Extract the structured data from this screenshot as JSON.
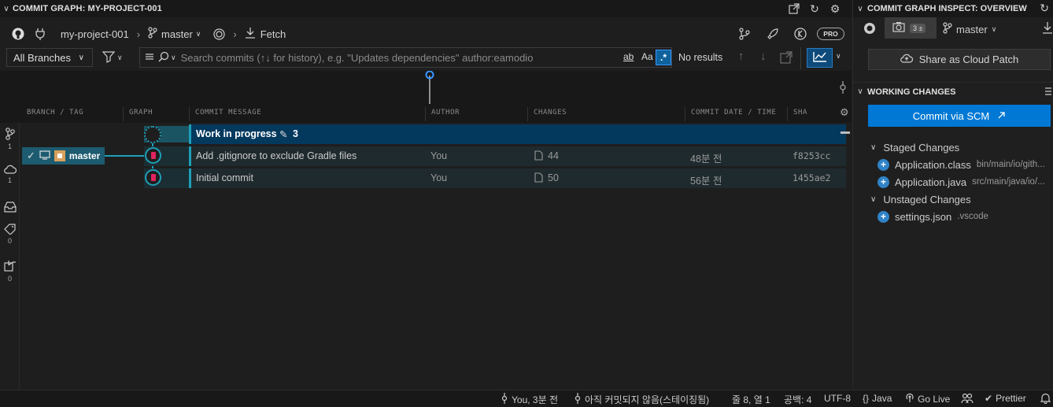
{
  "left_panel": {
    "title": "COMMIT GRAPH: MY-PROJECT-001",
    "repo": "my-project-001",
    "branch": "master",
    "fetch_label": "Fetch",
    "pro_badge": "PRO",
    "branch_filter": "All Branches",
    "search_placeholder": "Search commits (↑↓ for history), e.g. \"Updates dependencies\" author:eamodio",
    "search_opt_word": "ab",
    "search_opt_case": "Aa",
    "search_opt_regex": ".*",
    "results": "No results",
    "columns": {
      "branch_tag": "BRANCH / TAG",
      "graph": "GRAPH",
      "message": "COMMIT MESSAGE",
      "author": "AUTHOR",
      "changes": "CHANGES",
      "date": "COMMIT DATE / TIME",
      "sha": "SHA"
    },
    "strip_counts": [
      "1",
      "1",
      "0",
      "0"
    ],
    "wip": {
      "message": "Work in progress",
      "count": "3"
    },
    "branch_label": "master",
    "commits": [
      {
        "message": "Add .gitignore to exclude Gradle files",
        "author": "You",
        "changes": "44",
        "date": "48분 전",
        "sha": "f8253cc"
      },
      {
        "message": "Initial commit",
        "author": "You",
        "changes": "50",
        "date": "56분 전",
        "sha": "1455ae2"
      }
    ]
  },
  "right_panel": {
    "title": "COMMIT GRAPH INSPECT: OVERVIEW",
    "changes_badge": "3 ±",
    "branch": "master",
    "share_label": "Share as Cloud Patch",
    "working_changes_title": "WORKING CHANGES",
    "commit_scm_label": "Commit via SCM",
    "staged_title": "Staged Changes",
    "unstaged_title": "Unstaged Changes",
    "staged": [
      {
        "name": "Application.class",
        "path": "bin/main/io/gith..."
      },
      {
        "name": "Application.java",
        "path": "src/main/java/io/..."
      }
    ],
    "unstaged": [
      {
        "name": "settings.json",
        "path": ".vscode"
      }
    ]
  },
  "status_bar": {
    "blame": "You, 3분 전",
    "uncommitted": "아직 커밋되지 않음(스테이징됨)",
    "position": "줄 8, 열 1",
    "spaces": "공백: 4",
    "encoding": "UTF-8",
    "language": "Java",
    "go_live": "Go Live",
    "prettier": "Prettier"
  },
  "colors": {
    "accent": "#0078d4",
    "graph_line": "#1f9fb8",
    "commit_node": "#e0245e",
    "wip_row": "#04395e",
    "branch_tag_bg": "#1d5b70"
  }
}
